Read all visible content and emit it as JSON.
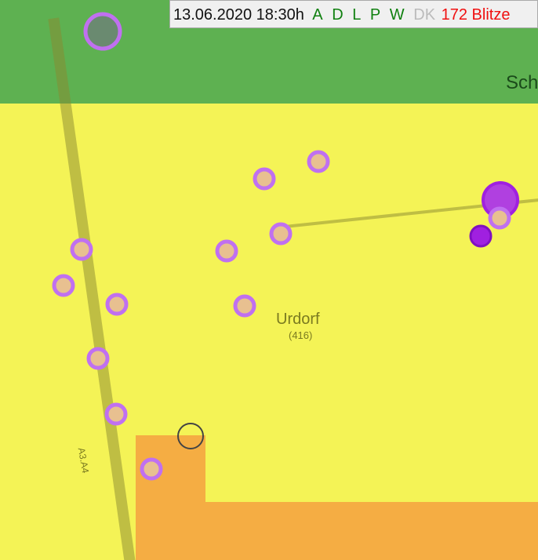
{
  "header": {
    "datetime": "13.06.2020 18:30h",
    "sources": [
      "A",
      "D",
      "L",
      "P",
      "W"
    ],
    "inactive_source": "DK",
    "count_text": "172 Blitze"
  },
  "colors": {
    "green": "#4caf3c",
    "yellow": "#f4f43c",
    "orange": "#f4a040",
    "strike": "#c070f0",
    "active": "#a020e0"
  },
  "map_labels": {
    "town": "Urdorf",
    "elevation": "(416)",
    "road": "A3.A4",
    "partial": "Sch"
  }
}
